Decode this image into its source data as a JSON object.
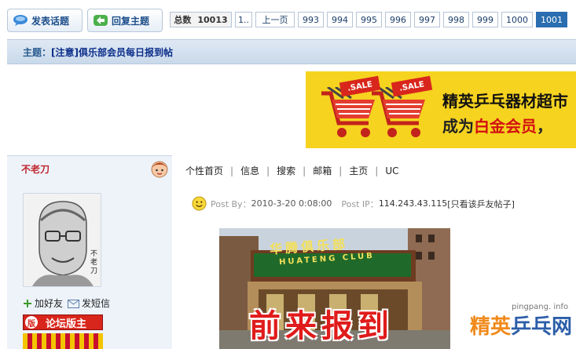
{
  "toolbar": {
    "new_topic_label": "发表话题",
    "reply_topic_label": "回复主题"
  },
  "pager": {
    "total_label": "总数",
    "total_value": "10013",
    "first": "1..",
    "prev": "上一页",
    "pages": [
      "993",
      "994",
      "995",
      "996",
      "997",
      "998",
      "999",
      "1000",
      "1001"
    ],
    "current": "1001"
  },
  "subject": {
    "label": "主题：",
    "title": "[注意]俱乐部会员每日报到帖"
  },
  "banner": {
    "sale_tag": ".SALE",
    "line1": "精英乒乓器材超市",
    "line2_prefix": "成为",
    "line2_highlight": "白金会员",
    "line2_suffix": "，"
  },
  "user": {
    "name": "不老刀",
    "avatar_text": [
      "不",
      "老",
      "刀"
    ],
    "add_friend_label": "加好友",
    "send_msg_label": "发短信",
    "moderator_badge": "论坛版主",
    "moderator_badge_icon": "版"
  },
  "post_links": [
    "个性首页",
    "信息",
    "搜索",
    "邮箱",
    "主页",
    "UC"
  ],
  "post_meta": {
    "posted_by_label": "Post By：",
    "posted_date": "2010-3-20 0:08:00",
    "ip_label": "Post IP：",
    "ip": "114.243.43.115",
    "only_view": "[只看该乒友帖子]"
  },
  "photo": {
    "sign_chars": "华腾俱乐部",
    "sign_latin": "HUATENG CLUB",
    "overlay_text": "前来报到"
  },
  "watermark": {
    "url": "pingpang. info",
    "logo_orange": "精英",
    "logo_blue": "乒乓网"
  },
  "colors": {
    "accent_blue": "#2a6db0",
    "title_blue": "#0a2d8a",
    "username_red": "#c0262f",
    "banner_yellow": "#f6d31f",
    "sale_red": "#d9261c"
  }
}
